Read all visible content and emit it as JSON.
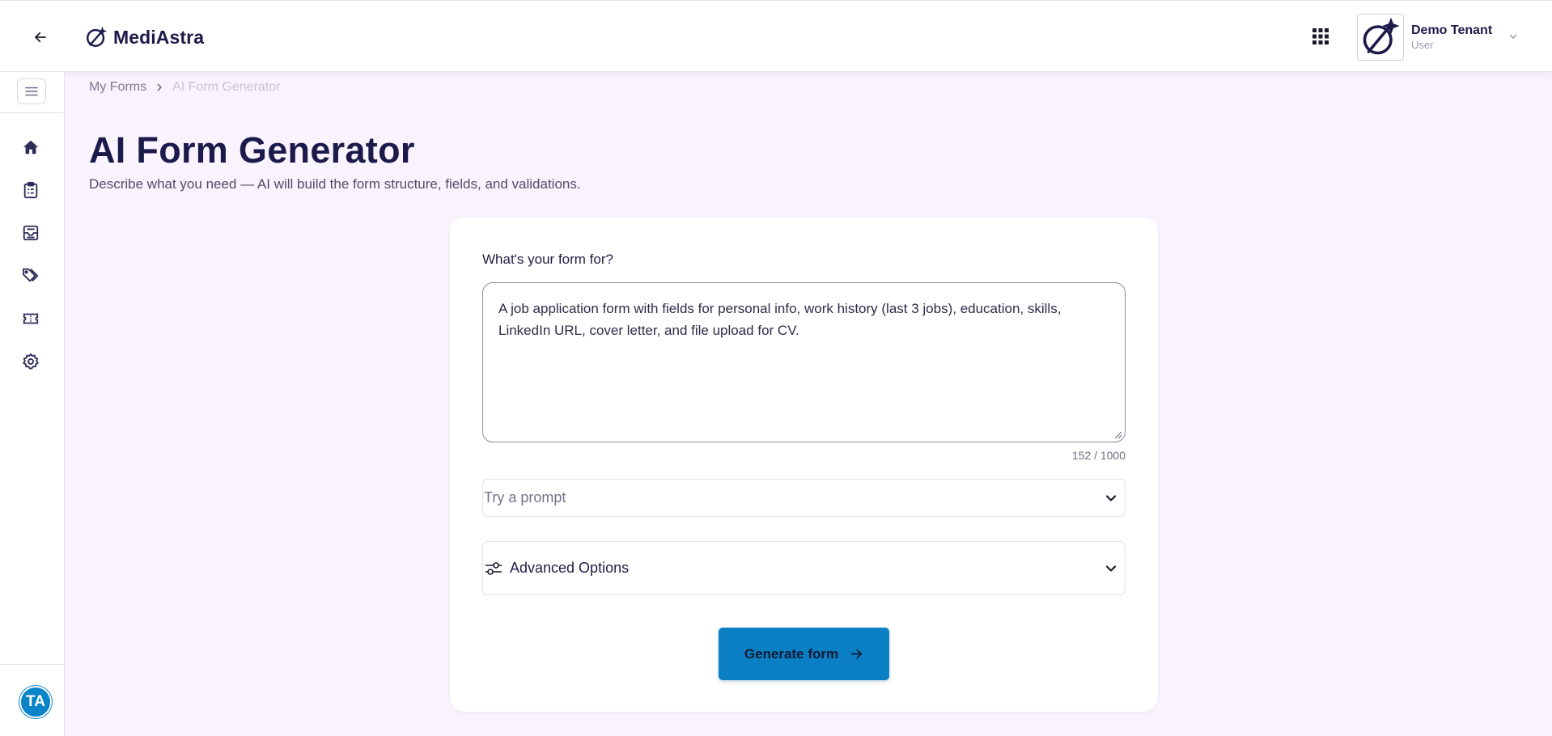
{
  "brand": {
    "name": "MediAstra",
    "accent": "#0a7fc4",
    "text_dark": "#1b1a4a",
    "background": "#f8f3fd"
  },
  "header": {
    "back_icon": "arrow-left-icon",
    "apps_icon": "grid-icon",
    "user": {
      "name": "Demo Tenant",
      "role": "User",
      "avatar_icon": "astra-logo-icon",
      "chevron_icon": "chevron-down-icon"
    }
  },
  "sidebar": {
    "toggle_icon": "menu-icon",
    "items": [
      {
        "name": "home",
        "icon": "home-icon"
      },
      {
        "name": "forms",
        "icon": "clipboard-icon"
      },
      {
        "name": "submissions",
        "icon": "inbox-icon"
      },
      {
        "name": "tags",
        "icon": "tags-icon"
      },
      {
        "name": "tickets",
        "icon": "ticket-icon"
      },
      {
        "name": "settings",
        "icon": "gear-icon"
      }
    ],
    "profile_initials": "TA"
  },
  "breadcrumb": {
    "items": [
      "My Forms",
      "AI Form Generator"
    ],
    "separator_icon": "chevron-right-icon"
  },
  "page": {
    "title": "AI Form Generator",
    "subtitle": "Describe what you need — AI will build the form structure, fields, and validations."
  },
  "form": {
    "label": "What's your form for?",
    "prompt_value": "A job application form with fields for personal info, work history (last 3 jobs), education, skills, LinkedIn URL, cover letter, and file upload for CV.",
    "char_count": "152 / 1000",
    "prompt_select_placeholder": "Try a prompt",
    "advanced_label": "Advanced Options",
    "advanced_icon": "sliders-icon",
    "generate_label": "Generate form",
    "generate_icon": "arrow-right-icon"
  }
}
